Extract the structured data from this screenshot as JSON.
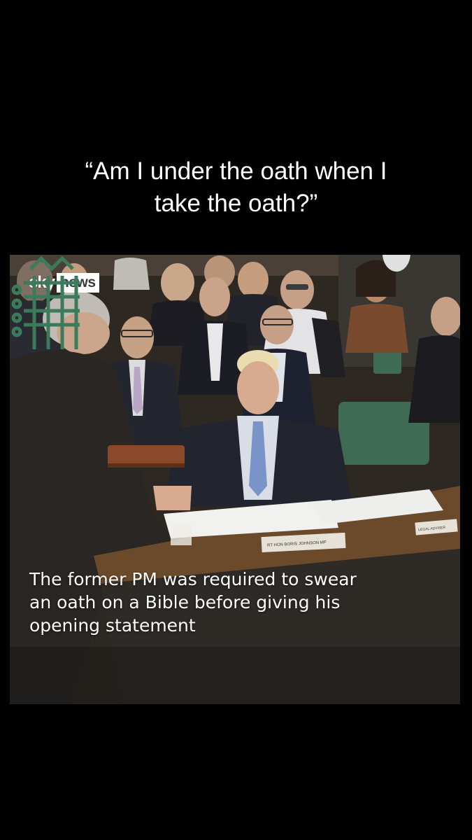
{
  "caption": {
    "line1": "“Am I under the oath when I",
    "line2": "take the oath?”"
  },
  "video": {
    "logo": {
      "sky": "sky",
      "news": "news"
    },
    "subtitle": {
      "line1": "The former PM was required to swear",
      "line2": "an oath on a Bible before giving his",
      "line3": "opening statement"
    },
    "name_plate": "RT HON BORIS JOHNSON MP",
    "side_plate": "LEGAL ADVISER",
    "colors": {
      "background": "#000000",
      "caption_text": "#ffffff",
      "desk": "#6b4a2c",
      "bench": "#3f6b55",
      "portcullis": "#3b7a5a"
    }
  }
}
